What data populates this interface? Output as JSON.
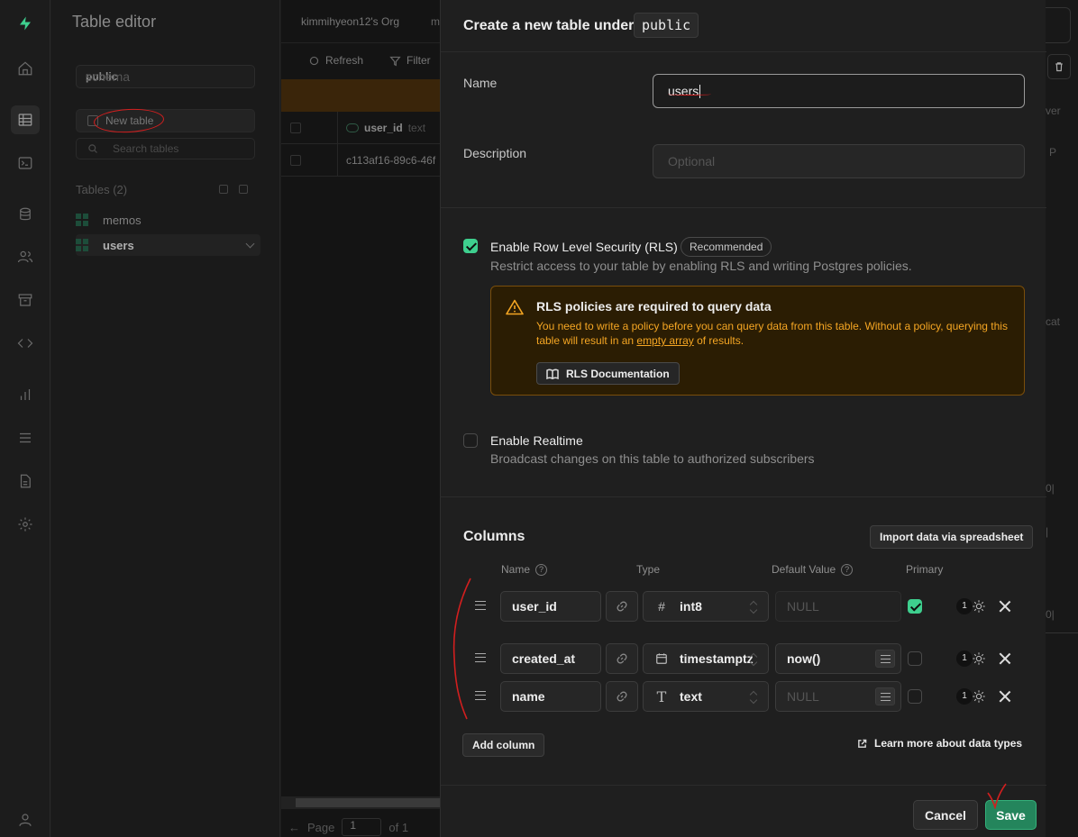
{
  "sidebar": {
    "title": "Table editor",
    "schema_label": "schema",
    "schema_value": "public",
    "new_table_label": "New table",
    "search_placeholder": "Search tables",
    "tables_header": "Tables (2)",
    "tables": [
      {
        "label": "memos"
      },
      {
        "label": "users"
      }
    ]
  },
  "main": {
    "org_label": "kimmihyeon12's Org",
    "project_label_partial": "m",
    "refresh_label": "Refresh",
    "filter_label": "Filter",
    "grid": {
      "column_name": "user_id",
      "column_type": "text",
      "row_value": "c113af16-89c6-46f"
    },
    "pager": {
      "page_label": "Page",
      "page_value": "1",
      "of_label": "of 1"
    }
  },
  "right_peek": {
    "t1": "ver",
    "t2": "P",
    "t3": "cat",
    "t4": "0|",
    "t5": "|",
    "t6": "0|"
  },
  "panel": {
    "header_text": "Create a new table under",
    "schema_code": "public",
    "name_label": "Name",
    "name_value": "users",
    "description_label": "Description",
    "description_placeholder": "Optional",
    "rls": {
      "checked": true,
      "title": "Enable Row Level Security (RLS)",
      "badge": "Recommended",
      "description": "Restrict access to your table by enabling RLS and writing Postgres policies."
    },
    "alert": {
      "title": "RLS policies are required to query data",
      "body_pre": "You need to write a policy before you can query data from this table. Without a policy, querying this table will result in an ",
      "body_link": "empty array",
      "body_post": " of results.",
      "button_label": "RLS Documentation"
    },
    "realtime": {
      "checked": false,
      "title": "Enable Realtime",
      "description": "Broadcast changes on this table to authorized subscribers"
    },
    "columns": {
      "title": "Columns",
      "import_label": "Import data via spreadsheet",
      "headers": {
        "name": "Name",
        "type": "Type",
        "default": "Default Value",
        "primary": "Primary"
      },
      "rows": [
        {
          "name": "user_id",
          "type_icon": "#",
          "type": "int8",
          "default": "NULL",
          "default_is_placeholder": true,
          "primary": true,
          "count": "1"
        },
        {
          "name": "created_at",
          "type_icon": "calendar",
          "type": "timestamptz",
          "default": "now()",
          "default_is_placeholder": false,
          "primary": false,
          "count": "1"
        },
        {
          "name": "name",
          "type_icon": "T",
          "type": "text",
          "default": "NULL",
          "default_is_placeholder": true,
          "primary": false,
          "count": "1"
        }
      ],
      "add_column_label": "Add column",
      "learn_more_label": "Learn more about data types"
    },
    "footer": {
      "cancel_label": "Cancel",
      "save_label": "Save"
    }
  },
  "colors": {
    "accent_green": "#3ecf8e",
    "save_bg": "#24855c",
    "warning_text": "#f5a623",
    "warning_bg": "#2b1d03",
    "annotation_red": "#d21f1f"
  }
}
